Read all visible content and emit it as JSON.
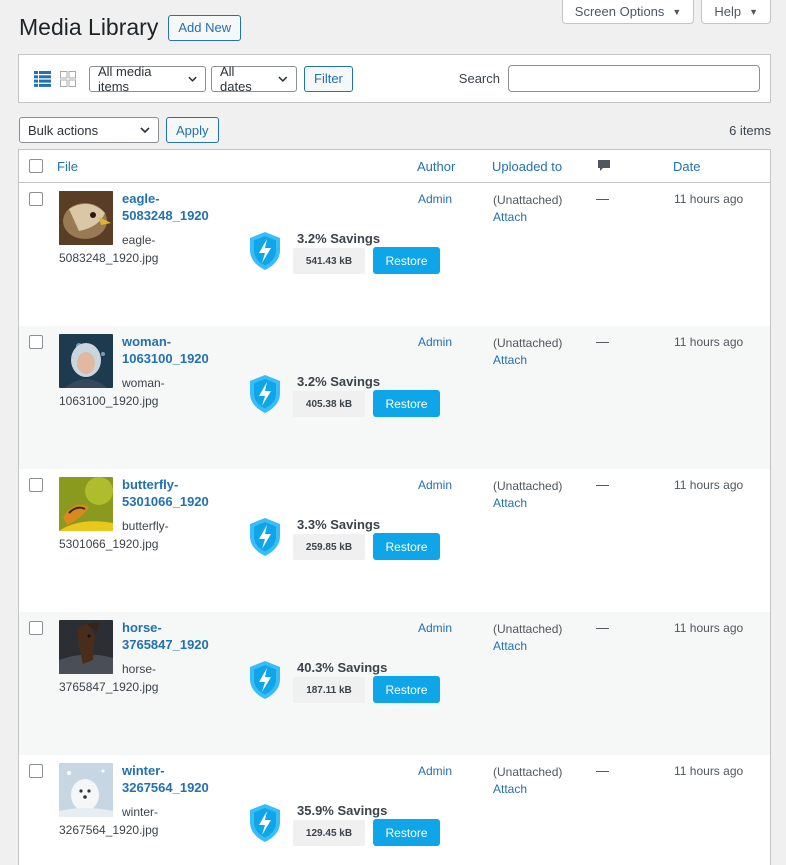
{
  "top_links": {
    "screen_options": "Screen Options",
    "help": "Help"
  },
  "header": {
    "title": "Media Library",
    "add_new": "Add New"
  },
  "filters": {
    "media_type": "All media items",
    "dates": "All dates",
    "filter_button": "Filter",
    "search_label": "Search",
    "search_value": ""
  },
  "bulk": {
    "selected": "Bulk actions",
    "apply": "Apply",
    "count": "6 items"
  },
  "table": {
    "columns": {
      "file": "File",
      "author": "Author",
      "uploaded_to": "Uploaded to",
      "date": "Date"
    },
    "rows": [
      {
        "title": "eagle-5083248_1920",
        "title_l1": "eagle-",
        "title_l2": "5083248_1920",
        "file_l1": "eagle-",
        "file_l2": "5083248_1920.jpg",
        "savings": "3.2% Savings",
        "size": "541.43 kB",
        "restore": "Restore",
        "author": "Admin",
        "uploaded": "(Unattached)",
        "attach": "Attach",
        "comments": "—",
        "date": "11 hours ago"
      },
      {
        "title": "woman-1063100_1920",
        "title_l1": "woman-",
        "title_l2": "1063100_1920",
        "file_l1": "woman-",
        "file_l2": "1063100_1920.jpg",
        "savings": "3.2% Savings",
        "size": "405.38 kB",
        "restore": "Restore",
        "author": "Admin",
        "uploaded": "(Unattached)",
        "attach": "Attach",
        "comments": "—",
        "date": "11 hours ago"
      },
      {
        "title": "butterfly-5301066_1920",
        "title_l1": "butterfly-",
        "title_l2": "5301066_1920",
        "file_l1": "butterfly-",
        "file_l2": "5301066_1920.jpg",
        "savings": "3.3% Savings",
        "size": "259.85 kB",
        "restore": "Restore",
        "author": "Admin",
        "uploaded": "(Unattached)",
        "attach": "Attach",
        "comments": "—",
        "date": "11 hours ago"
      },
      {
        "title": "horse-3765847_1920",
        "title_l1": "horse-",
        "title_l2": "3765847_1920",
        "file_l1": "horse-",
        "file_l2": "3765847_1920.jpg",
        "savings": "40.3% Savings",
        "size": "187.11 kB",
        "restore": "Restore",
        "author": "Admin",
        "uploaded": "(Unattached)",
        "attach": "Attach",
        "comments": "—",
        "date": "11 hours ago"
      },
      {
        "title": "winter-3267564_1920",
        "title_l1": "winter-",
        "title_l2": "3267564_1920",
        "file_l1": "winter-",
        "file_l2": "3267564_1920.jpg",
        "savings": "35.9% Savings",
        "size": "129.45 kB",
        "restore": "Restore",
        "author": "Admin",
        "uploaded": "(Unattached)",
        "attach": "Attach",
        "comments": "—",
        "date": "11 hours ago"
      }
    ]
  },
  "colors": {
    "link": "#2271b1",
    "restore_button": "#0ea5e9",
    "shield": "#38bdf8"
  }
}
